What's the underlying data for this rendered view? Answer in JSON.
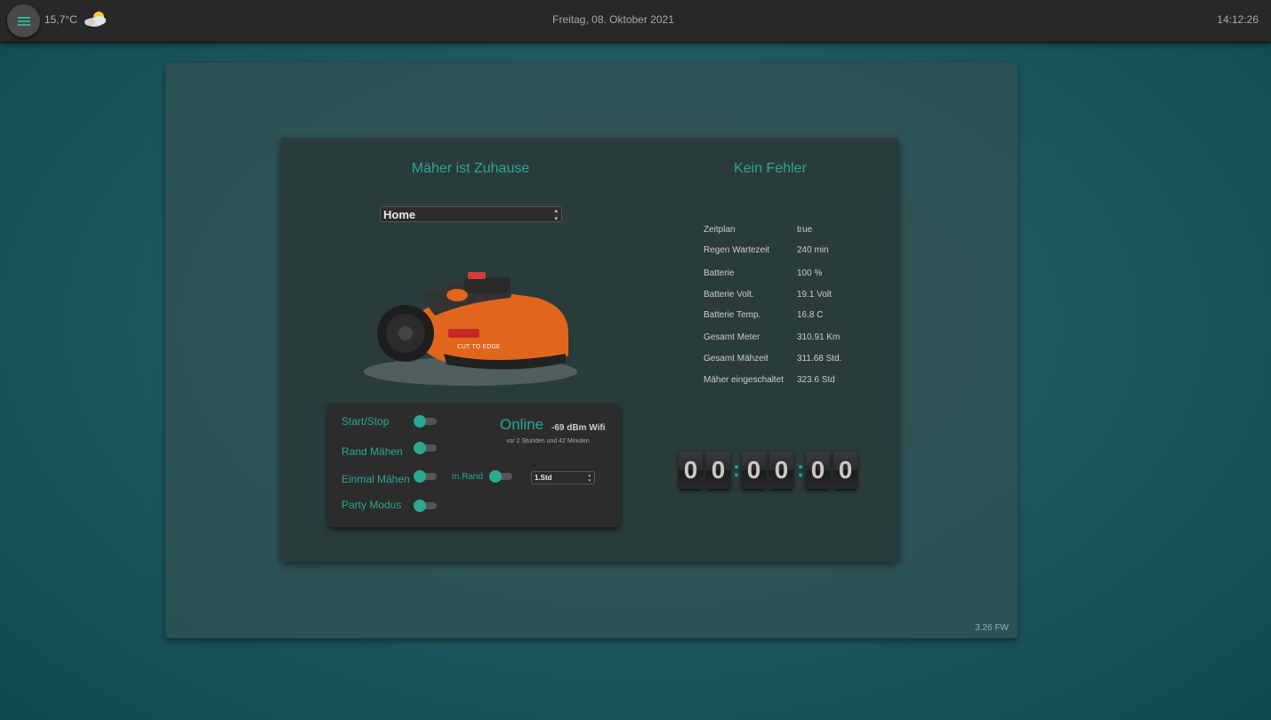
{
  "topbar": {
    "temperature": "15,7°C",
    "weather_icon": "partly-cloudy-icon",
    "date": "Freitag, 08. Oktober 2021",
    "time": "14:12:26",
    "accent": "#2fb09a"
  },
  "mower": {
    "status": "Mäher ist Zuhause",
    "error": "Kein Fehler",
    "zone_select": "Home",
    "firmware": "3.26 FW"
  },
  "controls": {
    "start_stop": "Start/Stop",
    "rand_maehen": "Rand Mähen",
    "einmal_maehen": "Einmal Mähen",
    "party_modus": "Party Modus",
    "m_rand": "m.Rand",
    "duration_select": "1.Std",
    "online": "Online",
    "wifi": "-69 dBm Wifi",
    "last_seen": "vor 2 Stunden und 42 Minuten"
  },
  "info": [
    {
      "key": "Zeitplan",
      "value": "true"
    },
    {
      "key": "Regen Wartezeit",
      "value": "240 min"
    },
    {
      "key": "Batterie",
      "value": "100 %"
    },
    {
      "key": "Batterie Volt.",
      "value": "19.1 Volt"
    },
    {
      "key": "Batterie Temp.",
      "value": "16.8 C"
    },
    {
      "key": "Gesamt Meter",
      "value": "310.91 Km"
    },
    {
      "key": "Gesamt Mähzeit",
      "value": "311.68 Std."
    },
    {
      "key": "Mäher eingeschaltet",
      "value": "323.6 Std"
    }
  ],
  "countdown": {
    "d1": "0",
    "d2": "0",
    "d3": "0",
    "d4": "0",
    "d5": "0",
    "d6": "0",
    "sep": ":"
  }
}
